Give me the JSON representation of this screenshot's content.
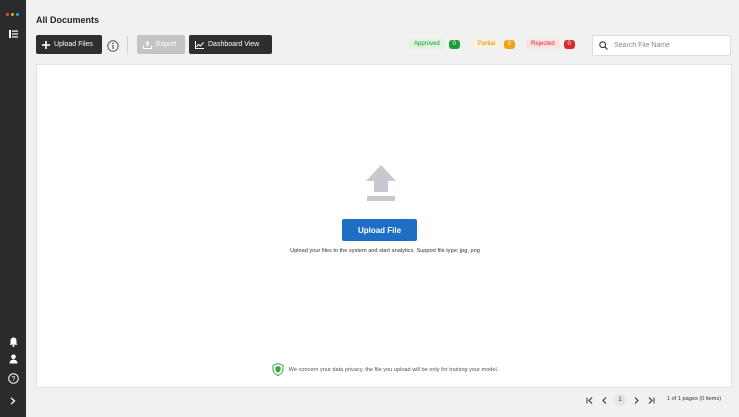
{
  "colors": {
    "sidebar_bg": "#2b2b2e",
    "primary": "#1e6fc4",
    "approved": "#1f9d3a",
    "partial": "#f0a315",
    "rejected": "#d92b2b"
  },
  "sidebar": {
    "logo_dot_colors": [
      "#e84c3d",
      "#f5a623",
      "#2f9be6",
      "#e84c3d"
    ],
    "icons": [
      "menu-icon",
      "bell-icon",
      "user-icon",
      "help-icon",
      "chevron-right-icon"
    ]
  },
  "header": {
    "title": "All Documents"
  },
  "toolbar": {
    "upload_files_label": "Upload Files",
    "export_label": "Export",
    "dashboard_view_label": "Dashboard View"
  },
  "status_filters": [
    {
      "label": "Approved",
      "count": "0"
    },
    {
      "label": "Partial",
      "count": "0"
    },
    {
      "label": "Rejected",
      "count": "0"
    }
  ],
  "search": {
    "placeholder": "Search File Name",
    "value": ""
  },
  "upload_area": {
    "button_label": "Upload File",
    "hint": "Upload your files to the system and start analytics. Support file type: jpg, png",
    "privacy_note": "We concern your data privacy, the file you upload will be only for training your model."
  },
  "pagination": {
    "current_page": "1",
    "summary": "1 of 1 pages (0 items)"
  }
}
